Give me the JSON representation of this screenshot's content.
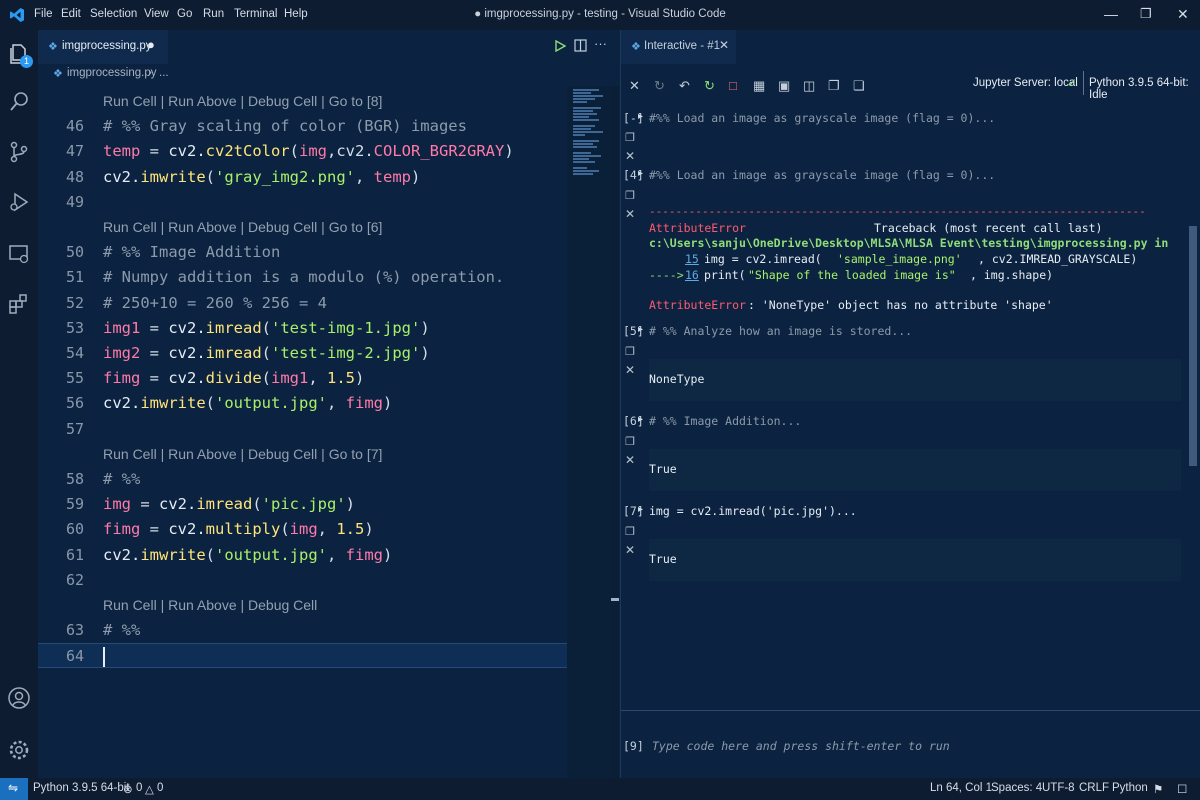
{
  "titlebar": {
    "menu": [
      "File",
      "Edit",
      "Selection",
      "View",
      "Go",
      "Run",
      "Terminal",
      "Help"
    ],
    "title": "● imgprocessing.py - testing - Visual Studio Code"
  },
  "activity": {
    "scm_badge": "1"
  },
  "editor": {
    "tab_label": "imgprocessing.py",
    "breadcrumb_file": "imgprocessing.py",
    "breadcrumb_more": "...",
    "lines": [
      {
        "ln": "",
        "lens": "Run Cell | Run Above | Debug Cell | Go to [8]"
      },
      {
        "ln": "46",
        "tokens": [
          [
            "c-cmt",
            "# %% Gray scaling of color (BGR) images"
          ]
        ]
      },
      {
        "ln": "47",
        "tokens": [
          [
            "c-var",
            "temp"
          ],
          [
            "c-op",
            " = "
          ],
          [
            "c-plain",
            "cv2."
          ],
          [
            "c-fn",
            "cv2tColor"
          ],
          [
            "c-op",
            "("
          ],
          [
            "c-var",
            "img"
          ],
          [
            "c-op",
            ",cv2."
          ],
          [
            "c-var",
            "COLOR_BGR2GRAY"
          ],
          [
            "c-op",
            ")"
          ]
        ]
      },
      {
        "ln": "48",
        "tokens": [
          [
            "c-plain",
            "cv2."
          ],
          [
            "c-fn",
            "imwrite"
          ],
          [
            "c-op",
            "("
          ],
          [
            "c-str",
            "'gray_img2.png'"
          ],
          [
            "c-op",
            ", "
          ],
          [
            "c-var",
            "temp"
          ],
          [
            "c-op",
            ")"
          ]
        ]
      },
      {
        "ln": "49",
        "tokens": []
      },
      {
        "ln": "",
        "lens": "Run Cell | Run Above | Debug Cell | Go to [6]"
      },
      {
        "ln": "50",
        "tokens": [
          [
            "c-cmt",
            "# %% Image Addition"
          ]
        ]
      },
      {
        "ln": "51",
        "tokens": [
          [
            "c-cmt",
            "# Numpy addition is a modulo (%) operation."
          ]
        ]
      },
      {
        "ln": "52",
        "tokens": [
          [
            "c-cmt",
            "# 250+10 = 260 % 256 = 4"
          ]
        ]
      },
      {
        "ln": "53",
        "tokens": [
          [
            "c-var",
            "img1"
          ],
          [
            "c-op",
            " = "
          ],
          [
            "c-plain",
            "cv2."
          ],
          [
            "c-fn",
            "imread"
          ],
          [
            "c-op",
            "("
          ],
          [
            "c-str",
            "'test-img-1.jpg'"
          ],
          [
            "c-op",
            ")"
          ]
        ]
      },
      {
        "ln": "54",
        "tokens": [
          [
            "c-var",
            "img2"
          ],
          [
            "c-op",
            " = "
          ],
          [
            "c-plain",
            "cv2."
          ],
          [
            "c-fn",
            "imread"
          ],
          [
            "c-op",
            "("
          ],
          [
            "c-str",
            "'test-img-2.jpg'"
          ],
          [
            "c-op",
            ")"
          ]
        ]
      },
      {
        "ln": "55",
        "tokens": [
          [
            "c-var",
            "fimg"
          ],
          [
            "c-op",
            " = "
          ],
          [
            "c-plain",
            "cv2."
          ],
          [
            "c-fn",
            "divide"
          ],
          [
            "c-op",
            "("
          ],
          [
            "c-var",
            "img1"
          ],
          [
            "c-op",
            ", "
          ],
          [
            "c-num",
            "1.5"
          ],
          [
            "c-op",
            ")"
          ]
        ]
      },
      {
        "ln": "56",
        "tokens": [
          [
            "c-plain",
            "cv2."
          ],
          [
            "c-fn",
            "imwrite"
          ],
          [
            "c-op",
            "("
          ],
          [
            "c-str",
            "'output.jpg'"
          ],
          [
            "c-op",
            ", "
          ],
          [
            "c-var",
            "fimg"
          ],
          [
            "c-op",
            ")"
          ]
        ]
      },
      {
        "ln": "57",
        "tokens": []
      },
      {
        "ln": "",
        "lens": "Run Cell | Run Above | Debug Cell | Go to [7]"
      },
      {
        "ln": "58",
        "tokens": [
          [
            "c-cmt",
            "# %%"
          ]
        ]
      },
      {
        "ln": "59",
        "tokens": [
          [
            "c-var",
            "img"
          ],
          [
            "c-op",
            " = "
          ],
          [
            "c-plain",
            "cv2."
          ],
          [
            "c-fn",
            "imread"
          ],
          [
            "c-op",
            "("
          ],
          [
            "c-str",
            "'pic.jpg'"
          ],
          [
            "c-op",
            ")"
          ]
        ]
      },
      {
        "ln": "60",
        "tokens": [
          [
            "c-var",
            "fimg"
          ],
          [
            "c-op",
            " = "
          ],
          [
            "c-plain",
            "cv2."
          ],
          [
            "c-fn",
            "multiply"
          ],
          [
            "c-op",
            "("
          ],
          [
            "c-var",
            "img"
          ],
          [
            "c-op",
            ", "
          ],
          [
            "c-num",
            "1.5"
          ],
          [
            "c-op",
            ")"
          ]
        ]
      },
      {
        "ln": "61",
        "tokens": [
          [
            "c-plain",
            "cv2."
          ],
          [
            "c-fn",
            "imwrite"
          ],
          [
            "c-op",
            "("
          ],
          [
            "c-str",
            "'output.jpg'"
          ],
          [
            "c-op",
            ", "
          ],
          [
            "c-var",
            "fimg"
          ],
          [
            "c-op",
            ")"
          ]
        ]
      },
      {
        "ln": "62",
        "tokens": []
      },
      {
        "ln": "",
        "lens": "Run Cell | Run Above | Debug Cell"
      },
      {
        "ln": "63",
        "tokens": [
          [
            "c-cmt",
            "# %%"
          ]
        ]
      },
      {
        "ln": "64",
        "tokens": [],
        "current": true
      }
    ]
  },
  "panel": {
    "tab_label": "Interactive - #1",
    "server_label": "Jupyter Server: local",
    "kernel_label": "Python 3.9.5 64-bit: Idle",
    "cells": [
      {
        "num": "[-]",
        "code": "#%% Load an image as grayscale image (flag = 0)..."
      },
      {
        "num": "[4]",
        "code": "#%% Load an image as grayscale image (flag = 0)..."
      },
      {
        "num": "[5]",
        "code": "# %% Analyze how an image is stored...",
        "output": "NoneType"
      },
      {
        "num": "[6]",
        "code": "# %% Image Addition...",
        "output": "True"
      },
      {
        "num": "[7]",
        "code": "img = cv2.imread('pic.jpg')...",
        "output": "True"
      }
    ],
    "error": {
      "rule": "---------------------------------------------------------------------------",
      "name": "AttributeError",
      "traceback": "Traceback (most recent call last)",
      "path": "c:\\Users\\sanju\\OneDrive\\Desktop\\MLSA\\MLSA Event\\testing\\imgprocessing.py in",
      "line15_num": "15",
      "line15_a": "img = cv2.imread(",
      "line15_str": "'sample_image.png'",
      "line15_b": ", cv2.IMREAD_GRAYSCALE)",
      "arrow": "---->",
      "line16_num": "16",
      "line16_a": "print(",
      "line16_str": "\"Shape of the loaded image is\"",
      "line16_b": ", img.shape)",
      "message_name": "AttributeError",
      "message_text": ": 'NoneType' object has no attribute 'shape'"
    },
    "input_num": "[9]",
    "input_placeholder": "Type code here and press shift-enter to run"
  },
  "statusbar": {
    "interpreter": "Python 3.9.5 64-bit",
    "errors": "0",
    "warnings": "0",
    "position": "Ln 64, Col 1",
    "spaces": "Spaces: 4",
    "encoding": "UTF-8",
    "eol": "CRLF",
    "language": "Python"
  }
}
